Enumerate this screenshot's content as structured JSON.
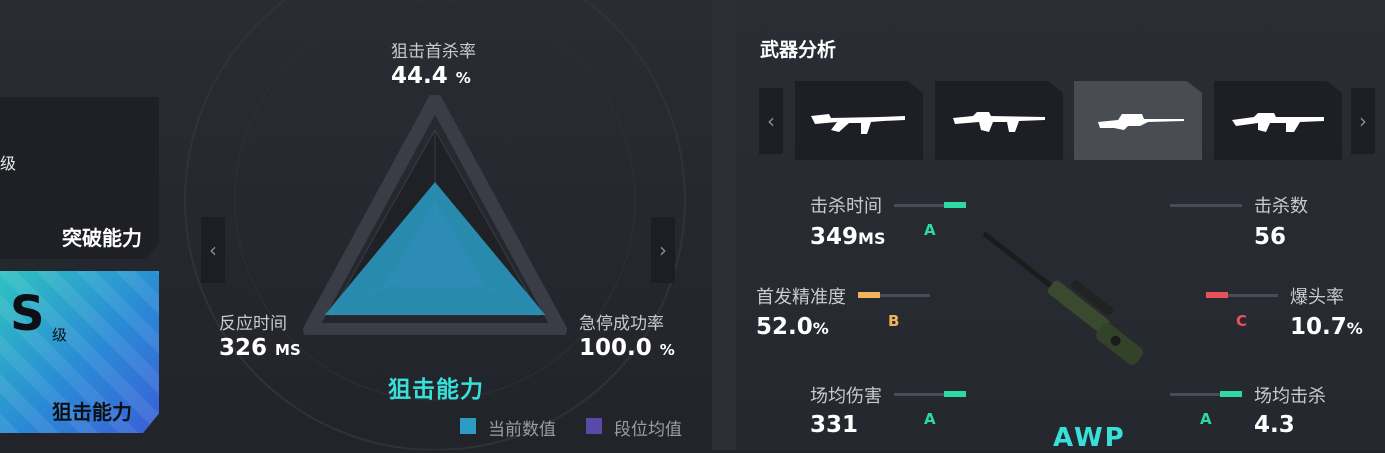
{
  "left_panel": {
    "partial_text": "级",
    "card_title": "突破能力",
    "grade": {
      "letter": "S",
      "suffix": "级",
      "label": "狙击能力"
    }
  },
  "radar": {
    "title": "狙击能力",
    "stats": [
      {
        "name": "狙击首杀率",
        "value": "44.4",
        "unit": "%"
      },
      {
        "name": "反应时间",
        "value": "326",
        "unit": "MS"
      },
      {
        "name": "急停成功率",
        "value": "100.0",
        "unit": "%"
      }
    ],
    "levels": {
      "current": [
        0.6,
        0.78,
        0.72
      ],
      "average": [
        0.45,
        0.5,
        0.5
      ]
    },
    "legend": [
      {
        "label": "当前数值",
        "color": "#2a9cc4"
      },
      {
        "label": "段位均值",
        "color": "#5a4aa8"
      }
    ],
    "nav_prev": "‹",
    "nav_next": "›"
  },
  "weapons": {
    "title": "武器分析",
    "nav_prev": "‹",
    "nav_next": "›",
    "list": [
      {
        "icon": "ak47-icon"
      },
      {
        "icon": "m4-icon"
      },
      {
        "icon": "awp-icon",
        "selected": true
      },
      {
        "icon": "m4a1-icon"
      }
    ],
    "selected_name": "AWP",
    "stats": {
      "kill_time": {
        "name": "击杀时间",
        "value": "349",
        "unit": "MS",
        "grade": "A",
        "level": 0.3
      },
      "kills": {
        "name": "击杀数",
        "value": "56",
        "unit": "",
        "level": 0.0
      },
      "first_accuracy": {
        "name": "首发精准度",
        "value": "52.0",
        "unit": "%",
        "grade": "B",
        "level": 0.3
      },
      "headshot": {
        "name": "爆头率",
        "value": "10.7",
        "unit": "%",
        "grade": "C",
        "level": 0.3
      },
      "avg_damage": {
        "name": "场均伤害",
        "value": "331",
        "unit": "",
        "grade": "A",
        "level": 0.3
      },
      "avg_kills": {
        "name": "场均击杀",
        "value": "4.3",
        "unit": "",
        "grade": "A",
        "level": 0.3
      }
    },
    "grade_colors": {
      "A": "#2dd9a6",
      "B": "#f2b45a",
      "C": "#e8505b"
    }
  }
}
